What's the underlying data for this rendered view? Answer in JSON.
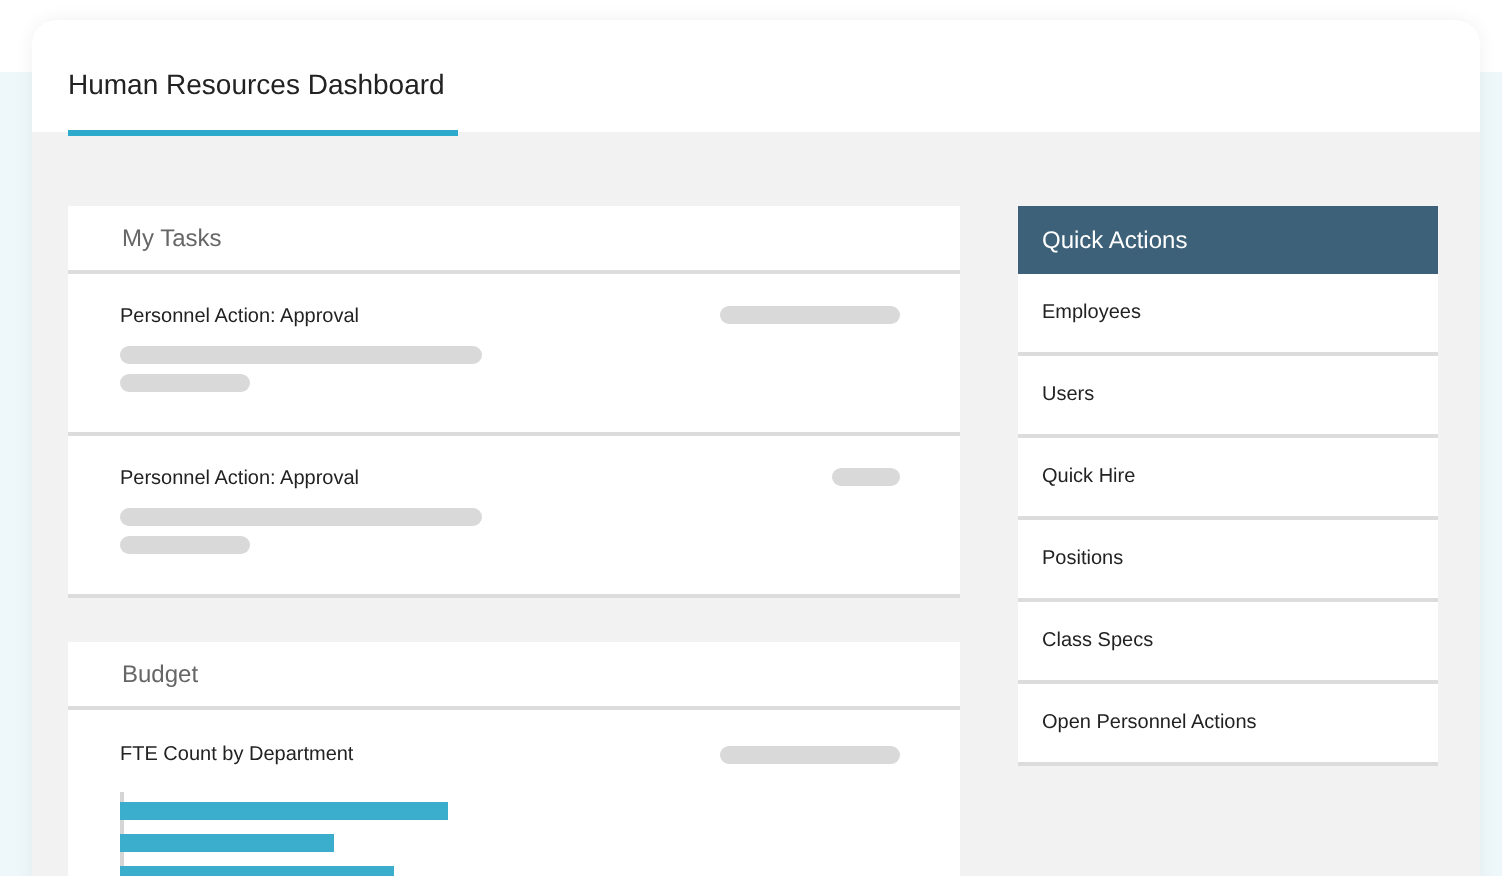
{
  "tabs": [
    {
      "label": "Human Resources Dashboard",
      "selected": true
    }
  ],
  "my_tasks": {
    "title": "My Tasks",
    "items": [
      {
        "title": "Personnel Action: Approval"
      },
      {
        "title": "Personnel Action: Approval"
      }
    ]
  },
  "budget": {
    "title": "Budget",
    "chart_title": "FTE Count by Department"
  },
  "quick_actions": {
    "title": "Quick Actions",
    "items": [
      "Employees",
      "Users",
      "Quick Hire",
      "Positions",
      "Class Specs",
      "Open Personnel Actions"
    ]
  }
}
